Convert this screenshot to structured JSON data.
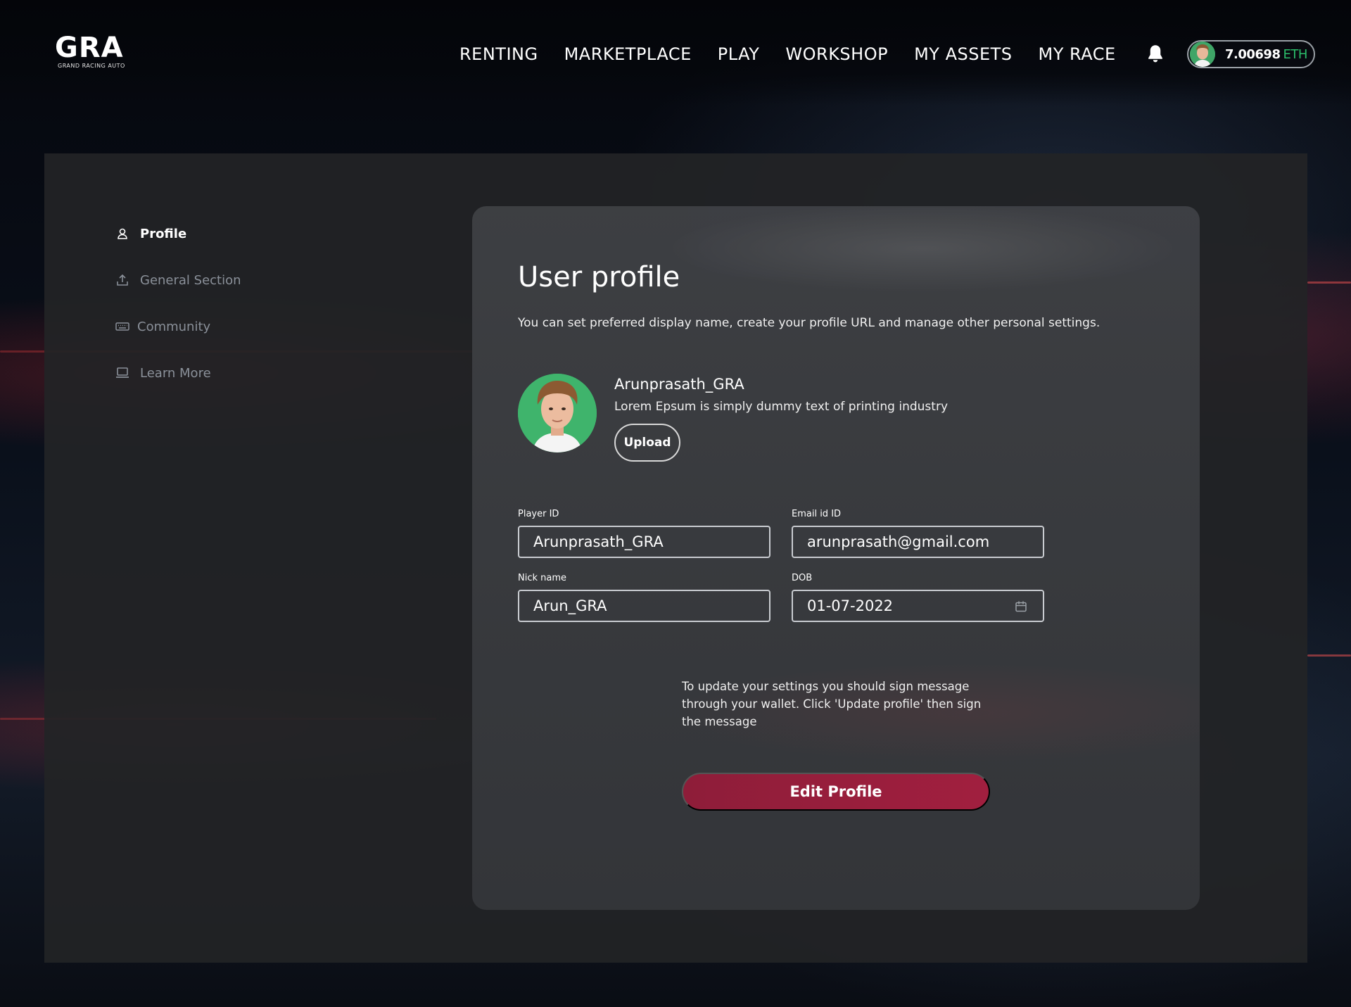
{
  "brand": {
    "logo_text": "GRA",
    "logo_subtext": "GRAND RACING AUTO"
  },
  "nav": {
    "items": [
      {
        "label": "RENTING"
      },
      {
        "label": "MARKETPLACE"
      },
      {
        "label": "PLAY"
      },
      {
        "label": "WORKSHOP"
      },
      {
        "label": "MY ASSETS"
      },
      {
        "label": "MY RACE"
      }
    ],
    "notification_icon": "bell-icon"
  },
  "wallet": {
    "amount": "7.00698",
    "unit": "ETH"
  },
  "sidebar": {
    "items": [
      {
        "label": "Profile",
        "icon": "user-icon",
        "active": true
      },
      {
        "label": "General Section",
        "icon": "upload-icon",
        "active": false
      },
      {
        "label": "Community",
        "icon": "keyboard-icon",
        "active": false
      },
      {
        "label": "Learn More",
        "icon": "laptop-icon",
        "active": false
      }
    ]
  },
  "profile": {
    "title": "User profile",
    "subtitle": "You can set preferred display name, create your profile URL and manage other personal settings.",
    "username": "Arunprasath_GRA",
    "bio": "Lorem Epsum is simply dummy text of printing industry",
    "upload_label": "Upload"
  },
  "form": {
    "player_id": {
      "label": "Player ID",
      "value": "Arunprasath_GRA"
    },
    "email": {
      "label": "Email id ID",
      "value": "arunprasath@gmail.com"
    },
    "nickname": {
      "label": "Nick name",
      "value": "Arun_GRA"
    },
    "dob": {
      "label": "DOB",
      "value": "01-07-2022"
    }
  },
  "update_note": "To update your settings you should sign message through your wallet. Click 'Update profile' then sign the message",
  "edit_button_label": "Edit Profile",
  "colors": {
    "accent": "#a11f3f",
    "eth_green": "#2bbd6a",
    "panel_bg": "#222326",
    "card_bg": "#404246"
  }
}
